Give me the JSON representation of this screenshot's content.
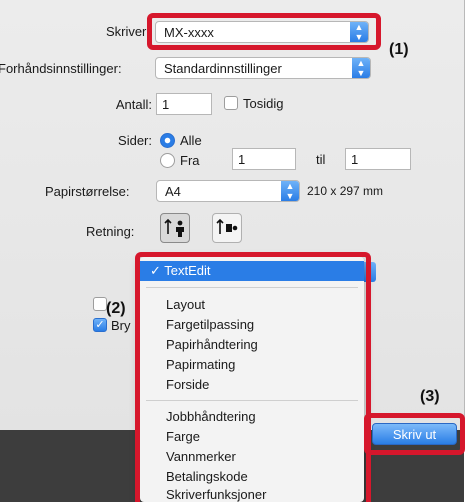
{
  "printer": {
    "label": "Skriver:",
    "value": "MX-xxxx"
  },
  "presets": {
    "label": "Forhåndsinnstillinger:",
    "value": "Standardinnstillinger"
  },
  "copies": {
    "label": "Antall:",
    "value": "1",
    "two_sided_label": "Tosidig"
  },
  "pages": {
    "label": "Sider:",
    "all_label": "Alle",
    "from_label": "Fra",
    "from_value": "1",
    "to_label": "til",
    "to_value": "1"
  },
  "paper_size": {
    "label": "Papirstørrelse:",
    "value": "A4",
    "dimensions": "210 x 297 mm"
  },
  "orientation": {
    "label": "Retning:"
  },
  "behind_menu": {
    "checkbox_partial_label": "Bry"
  },
  "callouts": {
    "one": "(1)",
    "two": "(2)",
    "three": "(3)"
  },
  "menu": {
    "selected": "✓ TextEdit",
    "group1": [
      "Layout",
      "Fargetilpassing",
      "Papirhåndtering",
      "Papirmating",
      "Forside"
    ],
    "group2": [
      "Jobbhåndtering",
      "Farge",
      "Vannmerker",
      "Betalingskode",
      "Skriverfunksjoner"
    ]
  },
  "print_button": {
    "label": "Skriv ut"
  },
  "colors": {
    "accent": "#2a7de6",
    "highlight_box": "#d6172c"
  }
}
